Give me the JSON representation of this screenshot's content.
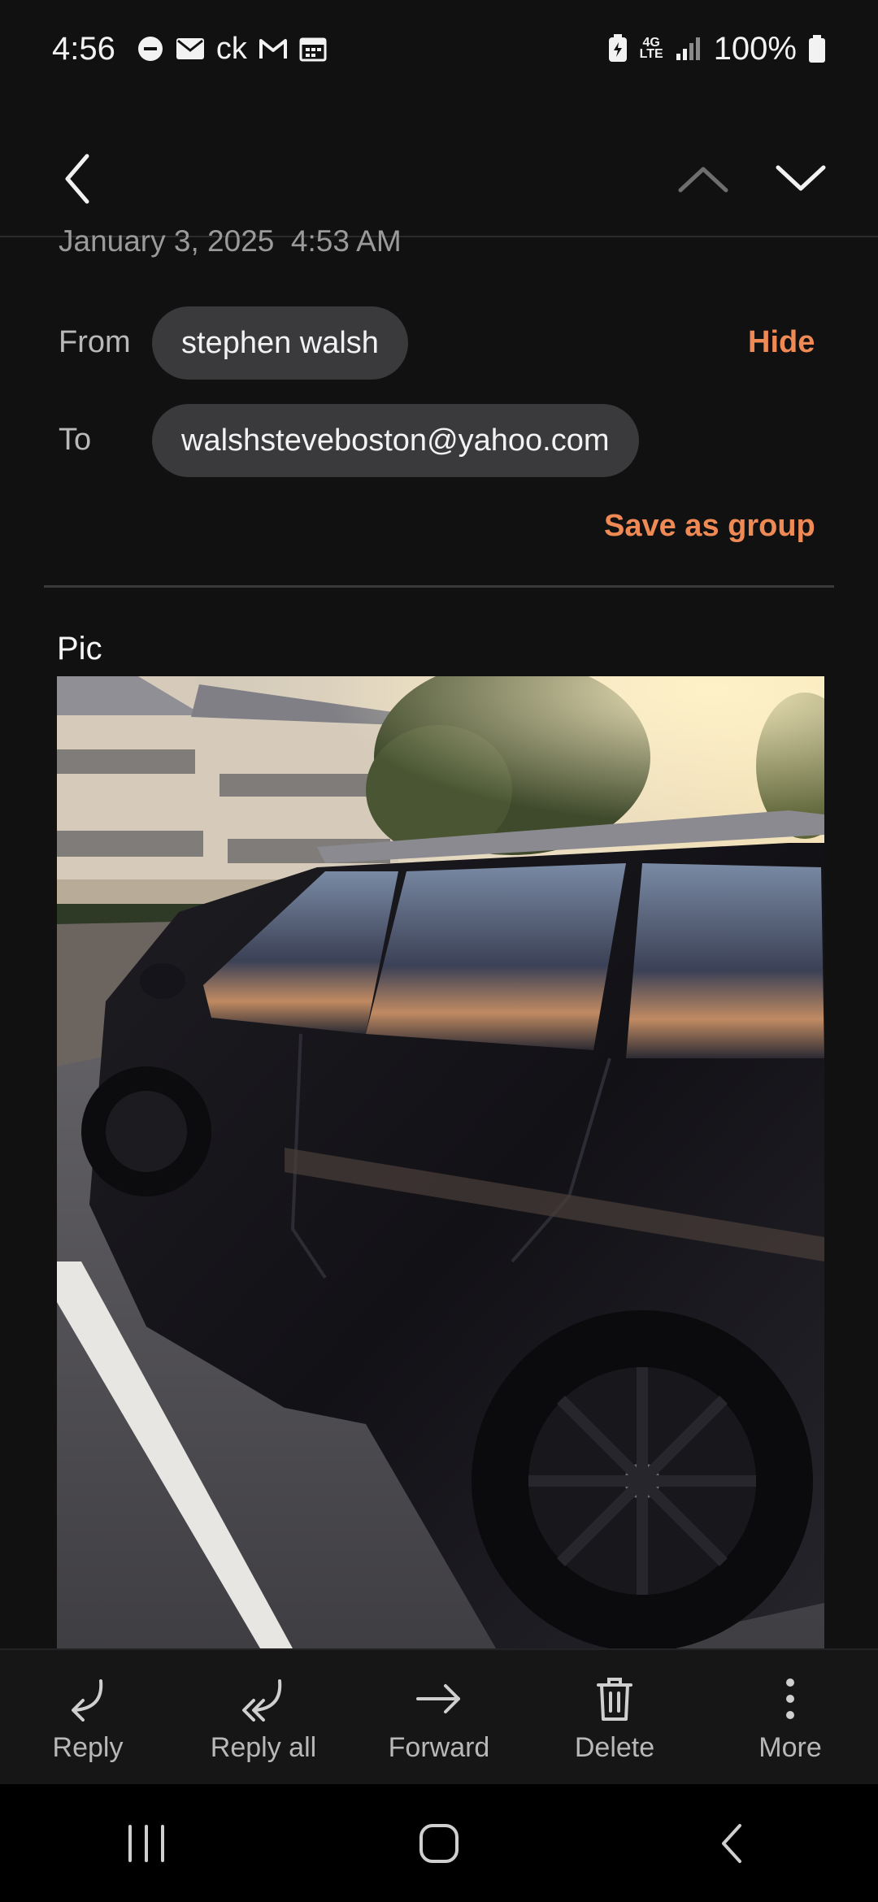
{
  "status_bar": {
    "time": "4:56",
    "carrier_icon_text": "ck",
    "network_label_top": "4G",
    "network_label_bottom": "LTE",
    "battery": "100%"
  },
  "header": {
    "date": "January 3, 2025  4:53 AM",
    "from_label": "From",
    "from_value": "stephen walsh",
    "hide_label": "Hide",
    "to_label": "To",
    "to_value": "walshsteveboston@yahoo.com",
    "save_group_label": "Save as group"
  },
  "body": {
    "subject_text": "Pic"
  },
  "actions": [
    {
      "label": "Reply",
      "icon": "reply-icon"
    },
    {
      "label": "Reply all",
      "icon": "reply-all-icon"
    },
    {
      "label": "Forward",
      "icon": "forward-icon"
    },
    {
      "label": "Delete",
      "icon": "trash-icon"
    },
    {
      "label": "More",
      "icon": "more-vertical-icon"
    }
  ],
  "colors": {
    "background": "#111112",
    "accent": "#f08a55",
    "chip": "#3a3a3c"
  }
}
